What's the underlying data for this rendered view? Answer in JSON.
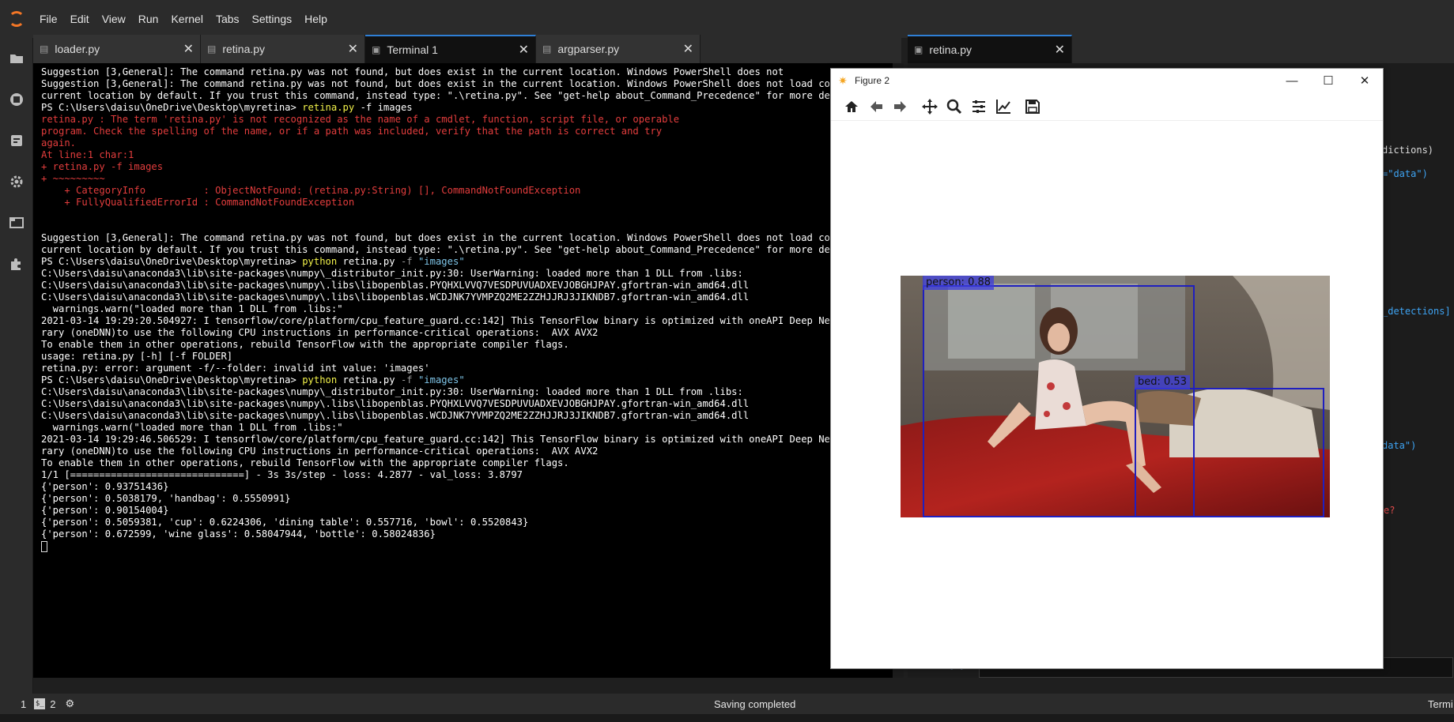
{
  "menu": {
    "items": [
      "File",
      "Edit",
      "View",
      "Run",
      "Kernel",
      "Tabs",
      "Settings",
      "Help"
    ]
  },
  "sidebar": {
    "icons": [
      "folder-icon",
      "running-icon",
      "commands-icon",
      "gear-icon",
      "tabs-icon",
      "extension-icon"
    ]
  },
  "tabs_left": [
    {
      "label": "loader.py",
      "icon": "python-file-icon",
      "active": false
    },
    {
      "label": "retina.py",
      "icon": "python-file-icon",
      "active": false
    },
    {
      "label": "Terminal 1",
      "icon": "terminal-icon",
      "active": true
    },
    {
      "label": "argparser.py",
      "icon": "python-file-icon",
      "active": false
    }
  ],
  "tabs_right": [
    {
      "label": "retina.py",
      "icon": "python-file-icon",
      "active": true
    }
  ],
  "terminal": {
    "lines": [
      {
        "text": "Suggestion [3,General]: The command retina.py was not found, but does exist in the current location. Windows PowerShell does not"
      },
      {
        "text": "Suggestion [3,General]: The command retina.py was not found, but does exist in the current location. Windows PowerShell does not load commands"
      },
      {
        "text": "current location by default. If you trust this command, instead type: \".\\retina.py\". See \"get-help about_Command_Precedence\" for more details."
      },
      {
        "prompt": "PS C:\\Users\\daisu\\OneDrive\\Desktop\\myretina> ",
        "cmd": "retina.py",
        "args": " -f ",
        "rest": "images"
      },
      {
        "text": "retina.py : The term 'retina.py' is not recognized as the name of a cmdlet, function, script file, or operable",
        "color": "red"
      },
      {
        "text": "program. Check the spelling of the name, or if a path was included, verify that the path is correct and try",
        "color": "red"
      },
      {
        "text": "again.",
        "color": "red"
      },
      {
        "text": "At line:1 char:1",
        "color": "red"
      },
      {
        "text": "+ retina.py -f images",
        "color": "red"
      },
      {
        "text": "+ ~~~~~~~~~",
        "color": "red"
      },
      {
        "text": "    + CategoryInfo          : ObjectNotFound: (retina.py:String) [], CommandNotFoundException",
        "color": "red"
      },
      {
        "text": "    + FullyQualifiedErrorId : CommandNotFoundException",
        "color": "red"
      },
      {
        "text": ""
      },
      {
        "text": ""
      },
      {
        "text": "Suggestion [3,General]: The command retina.py was not found, but does exist in the current location. Windows PowerShell does not load commands"
      },
      {
        "text": "current location by default. If you trust this command, instead type: \".\\retina.py\". See \"get-help about_Command_Precedence\" for more details."
      },
      {
        "prompt": "PS C:\\Users\\daisu\\OneDrive\\Desktop\\myretina> ",
        "cmd": "python",
        "args": " retina.py ",
        "flag": "-f",
        "str": " \"images\""
      },
      {
        "text": "C:\\Users\\daisu\\anaconda3\\lib\\site-packages\\numpy\\_distributor_init.py:30: UserWarning: loaded more than 1 DLL from .libs:"
      },
      {
        "text": "C:\\Users\\daisu\\anaconda3\\lib\\site-packages\\numpy\\.libs\\libopenblas.PYQHXLVVQ7VESDPUVUADXEVJOBGHJPAY.gfortran-win_amd64.dll"
      },
      {
        "text": "C:\\Users\\daisu\\anaconda3\\lib\\site-packages\\numpy\\.libs\\libopenblas.WCDJNK7YVMPZQ2ME2ZZHJJRJ3JIKNDB7.gfortran-win_amd64.dll"
      },
      {
        "text": "  warnings.warn(\"loaded more than 1 DLL from .libs:\""
      },
      {
        "text": "2021-03-14 19:29:20.504927: I tensorflow/core/platform/cpu_feature_guard.cc:142] This TensorFlow binary is optimized with oneAPI Deep Neural Ne"
      },
      {
        "text": "rary (oneDNN)to use the following CPU instructions in performance-critical operations:  AVX AVX2"
      },
      {
        "text": "To enable them in other operations, rebuild TensorFlow with the appropriate compiler flags."
      },
      {
        "text": "usage: retina.py [-h] [-f FOLDER]"
      },
      {
        "text": "retina.py: error: argument -f/--folder: invalid int value: 'images'"
      },
      {
        "prompt": "PS C:\\Users\\daisu\\OneDrive\\Desktop\\myretina> ",
        "cmd": "python",
        "args": " retina.py ",
        "flag": "-f",
        "str": " \"images\""
      },
      {
        "text": "C:\\Users\\daisu\\anaconda3\\lib\\site-packages\\numpy\\_distributor_init.py:30: UserWarning: loaded more than 1 DLL from .libs:"
      },
      {
        "text": "C:\\Users\\daisu\\anaconda3\\lib\\site-packages\\numpy\\.libs\\libopenblas.PYQHXLVVQ7VESDPUVUADXEVJOBGHJPAY.gfortran-win_amd64.dll"
      },
      {
        "text": "C:\\Users\\daisu\\anaconda3\\lib\\site-packages\\numpy\\.libs\\libopenblas.WCDJNK7YVMPZQ2ME2ZZHJJRJ3JIKNDB7.gfortran-win_amd64.dll"
      },
      {
        "text": "  warnings.warn(\"loaded more than 1 DLL from .libs:\""
      },
      {
        "text": "2021-03-14 19:29:46.506529: I tensorflow/core/platform/cpu_feature_guard.cc:142] This TensorFlow binary is optimized with oneAPI Deep Neural Ne"
      },
      {
        "text": "rary (oneDNN)to use the following CPU instructions in performance-critical operations:  AVX AVX2"
      },
      {
        "text": "To enable them in other operations, rebuild TensorFlow with the appropriate compiler flags."
      },
      {
        "text": "1/1 [==============================] - 3s 3s/step - loss: 4.2877 - val_loss: 3.8797"
      },
      {
        "text": "{'person': 0.93751436}"
      },
      {
        "text": "{'person': 0.5038179, 'handbag': 0.5550991}"
      },
      {
        "text": "{'person': 0.90154004}"
      },
      {
        "text": "{'person': 0.5059381, 'cup': 0.6224306, 'dining table': 0.557716, 'bowl': 0.5520843}"
      },
      {
        "text": "{'person': 0.672599, 'wine glass': 0.58047944, 'bottle': 0.58024836}"
      },
      {
        "cursor": true
      }
    ]
  },
  "editor": {
    "fragments": [
      {
        "text": "dictions)",
        "kind": "plain"
      },
      {
        "text": "=\"data\")",
        "kind": "str"
      },
      {
        "text": "_detections]",
        "kind": "str"
      },
      {
        "text": "data\")",
        "kind": "str"
      },
      {
        "text": "e?",
        "kind": "red"
      }
    ],
    "prompt": "[ ]:"
  },
  "figure": {
    "title": "Figure 2",
    "window_buttons": {
      "minimize": "—",
      "maximize": "☐",
      "close": "✕"
    },
    "toolbar": [
      "home-icon",
      "back-icon",
      "forward-icon",
      "pan-icon",
      "zoom-icon",
      "configure-icon",
      "edit-axis-icon",
      "save-icon"
    ],
    "detections": [
      {
        "label": "person: 0.88"
      },
      {
        "label": "bed: 0.53"
      }
    ]
  },
  "status": {
    "left_number": "1",
    "terminals": "2",
    "message": "Saving completed",
    "right": "Termi"
  },
  "colors": {
    "accent": "#2f7fd6",
    "jupyter_orange": "#f37626",
    "error_red": "#e33d3d",
    "cmd_yellow": "#f2f24a",
    "detection_blue": "#1f1fbf"
  }
}
